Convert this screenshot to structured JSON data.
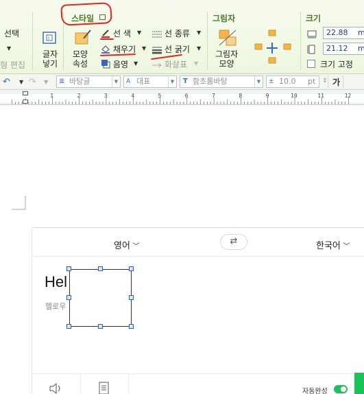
{
  "ribbon": {
    "style_group": {
      "title": "스타일",
      "shape_props": "모양\n속성",
      "line_color": "선 색",
      "fill": "채우기",
      "shadow": "음영",
      "line_type": "선 종류",
      "line_width": "선 굵기",
      "arrow": "화살표"
    },
    "left_partial": {
      "select": "선택",
      "edit": "형 편집"
    },
    "insert": {
      "text_box": "글자\n넣기"
    },
    "picture_group": {
      "title": "그림자",
      "shape": "그림자\n모양"
    },
    "size_group": {
      "title": "크기",
      "width_value": "22.88",
      "width_unit": "m",
      "height_value": "21.12",
      "height_unit": "m",
      "lock_size": "크기 고정"
    }
  },
  "format_bar": {
    "style_combo": "바탕글",
    "font_lang": "대표",
    "font_name": "함초롬바탕",
    "font_size": "10.0",
    "size_unit": "pt",
    "bold_glyph": "가"
  },
  "ruler": {
    "numbers": [
      "1",
      "2",
      "3",
      "4",
      "5",
      "6",
      "7",
      "8",
      "9",
      "10",
      "11",
      "12"
    ]
  },
  "translator": {
    "source_lang": "영어",
    "target_lang": "한국어",
    "swap_glyph": "⇄",
    "source_text": "Hel",
    "pronunciation": "헬로우",
    "autocomplete_label": "자동완성"
  },
  "annotations": {
    "color": "#e8221c"
  },
  "icons": [
    "volume-icon",
    "document-icon",
    "swap-icon",
    "undo-icon",
    "redo-icon"
  ]
}
